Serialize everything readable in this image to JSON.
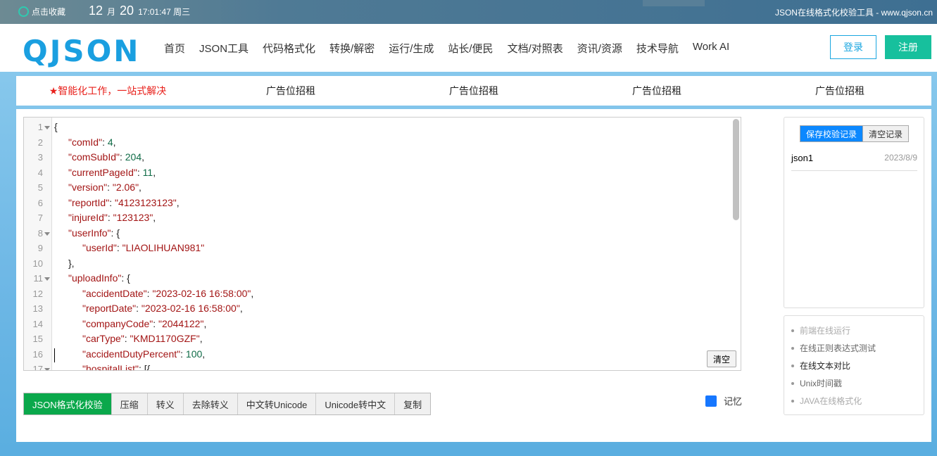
{
  "topbar": {
    "bookmark": "点击收藏",
    "month": "12",
    "month_unit": "月",
    "day": "20",
    "time": "17:01:47 周三",
    "site_title": "JSON在线格式化校验工具 - www.qjson.cn"
  },
  "header": {
    "logo": "QJSON",
    "nav": [
      "首页",
      "JSON工具",
      "代码格式化",
      "转换/解密",
      "运行/生成",
      "站长/便民",
      "文档/对照表",
      "资讯/资源",
      "技术导航",
      "Work AI"
    ],
    "login": "登录",
    "register": "注册"
  },
  "ads": [
    "★智能化工作，一站式解决",
    "广告位招租",
    "广告位招租",
    "广告位招租",
    "广告位招租"
  ],
  "editor": {
    "lines": [
      {
        "n": "1",
        "fold": true,
        "i": 0,
        "p": "{"
      },
      {
        "n": "2",
        "i": 1,
        "k": "\"comId\"",
        "v": "4",
        "t": "n",
        "e": ","
      },
      {
        "n": "3",
        "i": 1,
        "k": "\"comSubId\"",
        "v": "204",
        "t": "n",
        "e": ","
      },
      {
        "n": "4",
        "i": 1,
        "k": "\"currentPageId\"",
        "v": "11",
        "t": "n",
        "e": ","
      },
      {
        "n": "5",
        "i": 1,
        "k": "\"version\"",
        "v": "\"2.06\"",
        "t": "s",
        "e": ","
      },
      {
        "n": "6",
        "i": 1,
        "k": "\"reportId\"",
        "v": "\"4123123123\"",
        "t": "s",
        "e": ","
      },
      {
        "n": "7",
        "i": 1,
        "k": "\"injureId\"",
        "v": "\"123123\"",
        "t": "s",
        "e": ","
      },
      {
        "n": "8",
        "fold": true,
        "i": 1,
        "k": "\"userInfo\"",
        "e": "{"
      },
      {
        "n": "9",
        "i": 2,
        "k": "\"userId\"",
        "v": "\"LIAOLIHUAN981\"",
        "t": "s",
        "e": ""
      },
      {
        "n": "10",
        "i": 1,
        "p": "},"
      },
      {
        "n": "11",
        "fold": true,
        "i": 1,
        "k": "\"uploadInfo\"",
        "e": "{"
      },
      {
        "n": "12",
        "i": 2,
        "k": "\"accidentDate\"",
        "v": "\"2023-02-16 16:58:00\"",
        "t": "s",
        "e": ","
      },
      {
        "n": "13",
        "i": 2,
        "k": "\"reportDate\"",
        "v": "\"2023-02-16 16:58:00\"",
        "t": "s",
        "e": ","
      },
      {
        "n": "14",
        "i": 2,
        "k": "\"companyCode\"",
        "v": "\"2044122\"",
        "t": "s",
        "e": ","
      },
      {
        "n": "15",
        "i": 2,
        "k": "\"carType\"",
        "v": "\"KMD1170GZF\"",
        "t": "s",
        "e": ","
      },
      {
        "n": "16",
        "i": 2,
        "k": "\"accidentDutyPercent\"",
        "v": "100",
        "t": "n",
        "e": ","
      },
      {
        "n": "17",
        "fold": true,
        "i": 2,
        "k": "\"hospitalList\"",
        "e": "[{"
      }
    ],
    "clear": "清空"
  },
  "toolbar": [
    "JSON格式化校验",
    "压缩",
    "转义",
    "去除转义",
    "中文转Unicode",
    "Unicode转中文",
    "复制"
  ],
  "memory": "记忆",
  "history": {
    "save": "保存校验记录",
    "clear": "清空记录",
    "items": [
      {
        "name": "json1",
        "date": "2023/8/9"
      }
    ]
  },
  "links": [
    {
      "label": "前端在线运行",
      "color": "#aaaaaa"
    },
    {
      "label": "在线正则表达式测试",
      "color": "#666666"
    },
    {
      "label": "在线文本对比",
      "color": "#222222"
    },
    {
      "label": "Unix时间戳",
      "color": "#666666"
    },
    {
      "label": "JAVA在线格式化",
      "color": "#aaaaaa"
    }
  ]
}
